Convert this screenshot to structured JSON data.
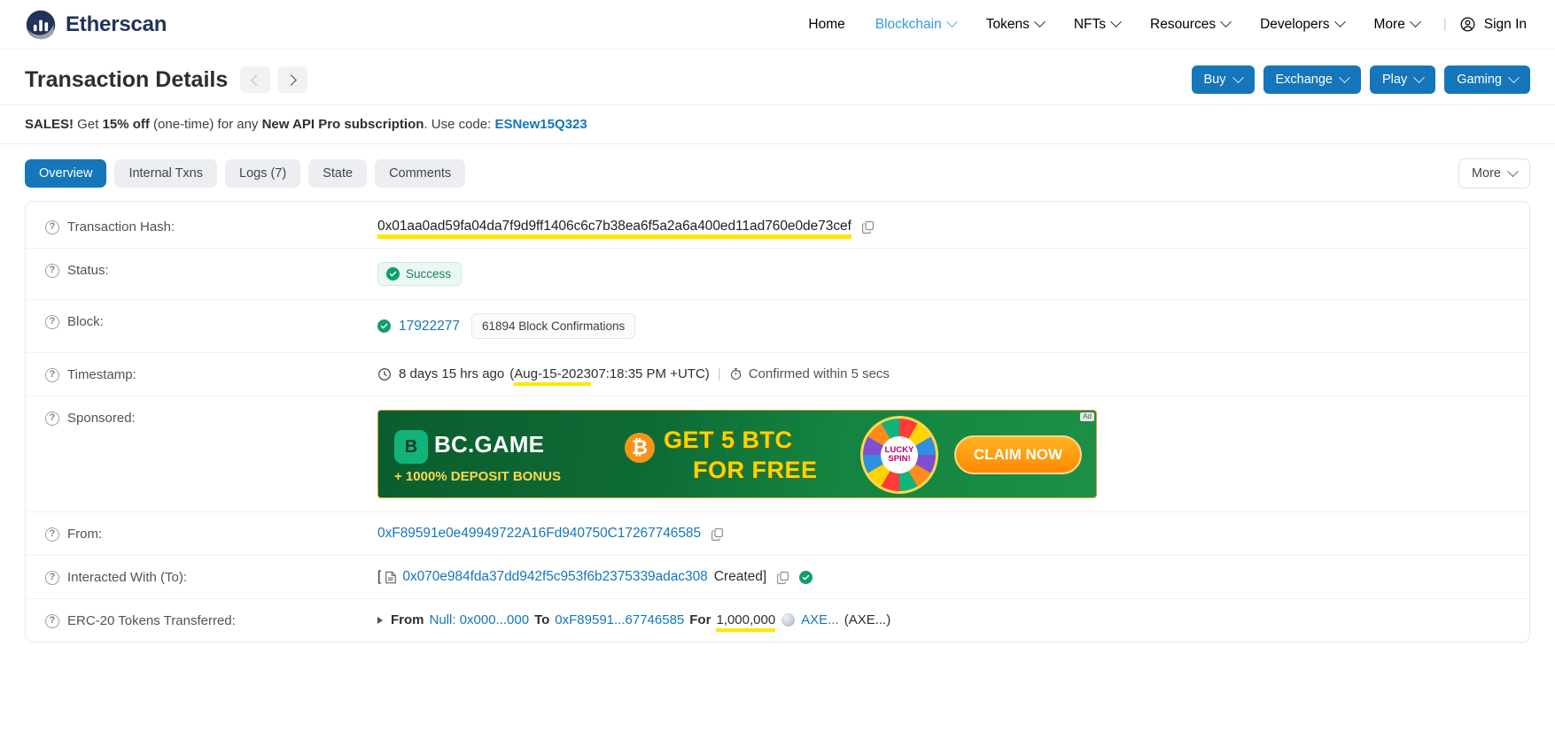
{
  "header": {
    "brand": "Etherscan",
    "nav": [
      {
        "label": "Home",
        "has_caret": false,
        "active": false
      },
      {
        "label": "Blockchain",
        "has_caret": true,
        "active": true
      },
      {
        "label": "Tokens",
        "has_caret": true,
        "active": false
      },
      {
        "label": "NFTs",
        "has_caret": true,
        "active": false
      },
      {
        "label": "Resources",
        "has_caret": true,
        "active": false
      },
      {
        "label": "Developers",
        "has_caret": true,
        "active": false
      },
      {
        "label": "More",
        "has_caret": true,
        "active": false
      }
    ],
    "separator": "|",
    "sign_in": "Sign In"
  },
  "titlebar": {
    "title": "Transaction Details",
    "prev_label": "‹",
    "next_label": "›",
    "promo_buttons": [
      {
        "label": "Buy"
      },
      {
        "label": "Exchange"
      },
      {
        "label": "Play"
      },
      {
        "label": "Gaming"
      }
    ]
  },
  "sales_banner": {
    "bold1": "SALES!",
    "text1": " Get ",
    "bold2": "15% off",
    "text2": " (one-time) for any ",
    "bold3": "New API Pro subscription",
    "text3": ". Use code: ",
    "code": "ESNew15Q323"
  },
  "tabs": [
    {
      "label": "Overview",
      "active": true
    },
    {
      "label": "Internal Txns",
      "active": false
    },
    {
      "label": "Logs (7)",
      "active": false
    },
    {
      "label": "State",
      "active": false
    },
    {
      "label": "Comments",
      "active": false
    }
  ],
  "more_button": "More",
  "details": {
    "transaction_hash": {
      "label": "Transaction Hash:",
      "value": "0x01aa0ad59fa04da7f9d9ff1406c6c7b38ea6f5a2a6a400ed11ad760e0de73cef",
      "highlighted": true
    },
    "status": {
      "label": "Status:",
      "value": "Success"
    },
    "block": {
      "label": "Block:",
      "number": "17922277",
      "confirmations": "61894 Block Confirmations"
    },
    "timestamp": {
      "label": "Timestamp:",
      "relative": "8 days 15 hrs ago",
      "paren_open": "(",
      "highlight_part": "Aug-15-2023",
      "rest": " 07:18:35 PM +UTC",
      "paren_close": ")",
      "separator": "|",
      "confirmed": "Confirmed within 5 secs"
    },
    "sponsored": {
      "label": "Sponsored:",
      "ad_brand": "BC.GAME",
      "ad_logo_letter": "B",
      "ad_sub": "+ 1000% DEPOSIT BONUS",
      "ad_btc_symbol": "₿",
      "ad_headline_1": "GET 5 BTC",
      "ad_headline_2": "FOR FREE",
      "ad_wheel_label": "LUCKY SPIN!",
      "ad_cta": "CLAIM NOW",
      "ad_marker": "Ad"
    },
    "from": {
      "label": "From:",
      "address": "0xF89591e0e49949722A16Fd940750C17267746585"
    },
    "interacted_with": {
      "label": "Interacted With (To):",
      "bracket_open": "[",
      "address": "0x070e984fda37dd942f5c953f6b2375339adac308",
      "created": "Created",
      "bracket_close": "]"
    },
    "erc20": {
      "label": "ERC-20 Tokens Transferred:",
      "from_kw": "From",
      "from_val": "Null: 0x000...000",
      "to_kw": "To",
      "to_val": "0xF89591...67746585",
      "for_kw": "For",
      "amount": "1,000,000",
      "token_short": "AXE...",
      "token_symbol": "(AXE...)"
    }
  },
  "colors": {
    "accent_blue": "#1576bb",
    "link_blue": "#1576bb",
    "brand_navy": "#21325b",
    "success_green": "#0f9d73",
    "highlight_yellow": "#ffe600"
  }
}
